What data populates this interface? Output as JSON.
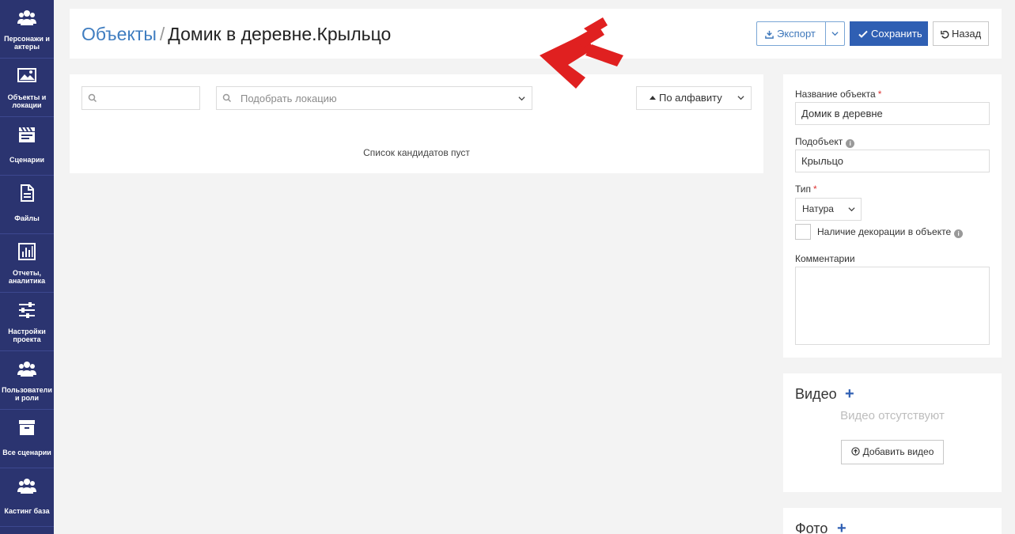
{
  "sidebar": {
    "items": [
      {
        "label": "Персонажи и актеры",
        "icon": "users-icon"
      },
      {
        "label": "Объекты и локации",
        "icon": "image-icon"
      },
      {
        "label": "Сценарии",
        "icon": "clapperboard-icon"
      },
      {
        "label": "Файлы",
        "icon": "file-icon"
      },
      {
        "label": "Отчеты, аналитика",
        "icon": "bar-chart-icon"
      },
      {
        "label": "Настройки проекта",
        "icon": "sliders-icon"
      },
      {
        "label": "Пользователи и роли",
        "icon": "users-icon"
      },
      {
        "label": "Все сценарии",
        "icon": "archive-icon"
      },
      {
        "label": "Кастинг база",
        "icon": "users-icon"
      }
    ]
  },
  "header": {
    "breadcrumb_link": "Объекты",
    "breadcrumb_sep": "/",
    "title": "Домик в деревне.Крыльцо",
    "export_label": "Экспорт",
    "save_label": "Сохранить",
    "back_label": "Назад"
  },
  "candidates": {
    "search_value": "",
    "location_placeholder": "Подобрать локацию",
    "sort_label": "По алфавиту",
    "empty_message": "Список кандидатов пуст"
  },
  "form": {
    "name_label": "Название объекта",
    "name_value": "Домик в деревне",
    "subobject_label": "Подобъект",
    "subobject_value": "Крыльцо",
    "type_label": "Тип",
    "type_value": "Натура",
    "decoration_label": "Наличие декорации в объекте",
    "decoration_checked": false,
    "comments_label": "Комментарии",
    "comments_value": ""
  },
  "video": {
    "title": "Видео",
    "empty": "Видео отсутствуют",
    "add_label": "Добавить видео"
  },
  "photo": {
    "title": "Фото"
  },
  "colors": {
    "sidebar": "#2b3470",
    "primary": "#2f5fb3",
    "link": "#3f7dc0",
    "arrow": "#e02020"
  }
}
